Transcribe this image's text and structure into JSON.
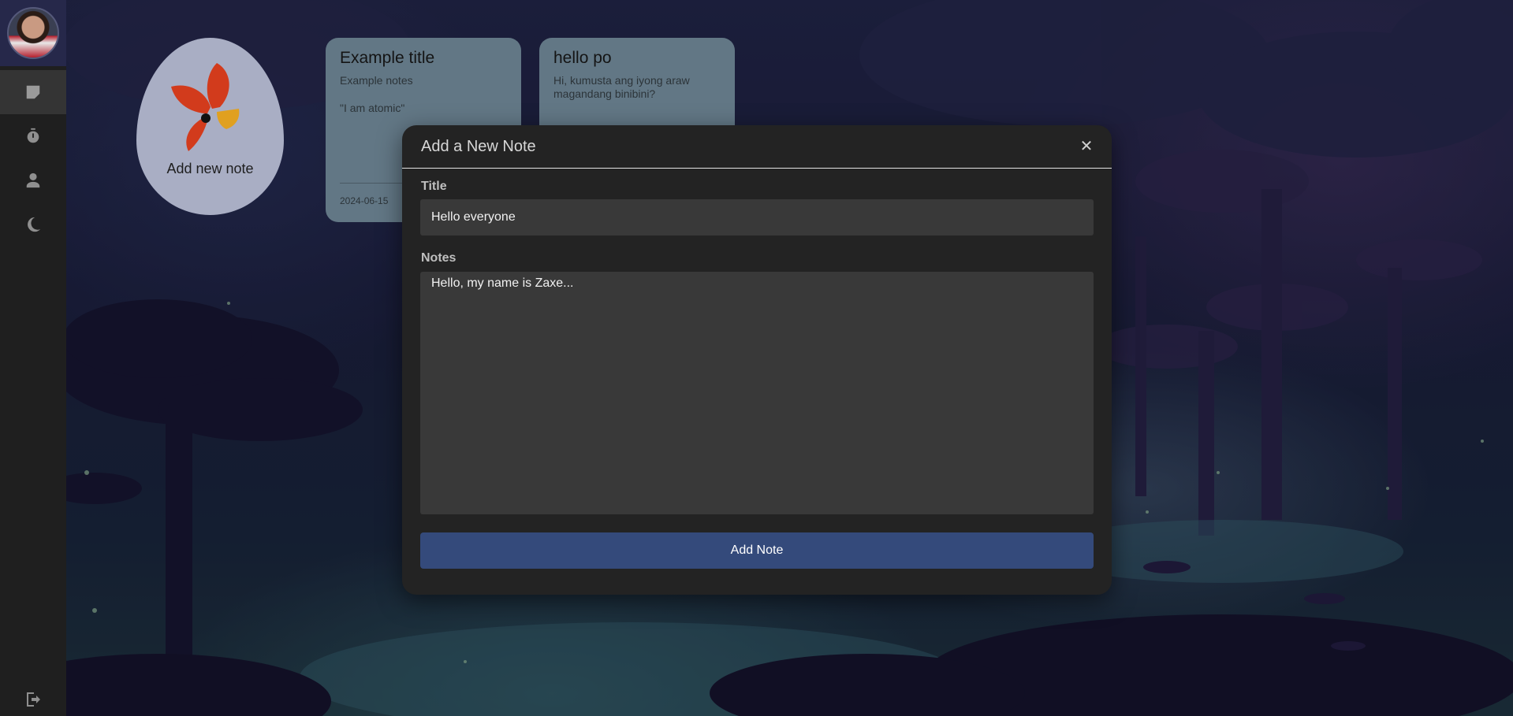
{
  "sidebar": {
    "items": [
      {
        "name": "notes",
        "icon": "sticky-note-icon",
        "active": true
      },
      {
        "name": "timer",
        "icon": "stopwatch-icon",
        "active": false
      },
      {
        "name": "profile",
        "icon": "user-icon",
        "active": false
      },
      {
        "name": "theme",
        "icon": "moon-icon",
        "active": false
      }
    ],
    "logout_icon": "logout-icon"
  },
  "add_note_card": {
    "label": "Add new note"
  },
  "notes": [
    {
      "title": "Example title",
      "body": "Example notes",
      "quote": "\"I am atomic\"",
      "date": "2024-06-15"
    },
    {
      "title": "hello po",
      "body": "Hi, kumusta ang iyong araw\nmagandang binibini?"
    }
  ],
  "modal": {
    "title": "Add a New Note",
    "close_label": "✕",
    "title_label": "Title",
    "title_value": "Hello everyone",
    "notes_label": "Notes",
    "notes_value": "Hello, my name is Zaxe...",
    "submit_label": "Add Note"
  },
  "colors": {
    "sidebar_bg": "#1f1f1f",
    "modal_bg": "#232323",
    "input_bg": "#393939",
    "button_bg": "#344a7b",
    "note_card_bg": "#627785",
    "add_card_bg": "#a9aec4"
  }
}
